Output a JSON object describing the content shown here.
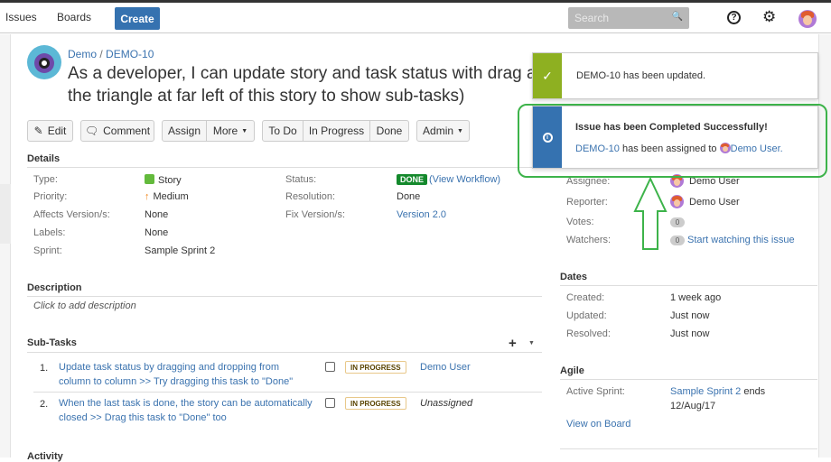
{
  "nav": {
    "issues": "Issues",
    "boards": "Boards",
    "create": "Create",
    "search_placeholder": "Search",
    "help_icon": "?"
  },
  "issue": {
    "project": "Demo",
    "key": "DEMO-10",
    "title_line1": "As a developer, I can update story and task status with drag a",
    "title_line2": "the triangle at far left of this story to show sub-tasks)"
  },
  "toolbar": {
    "edit": "Edit",
    "comment": "Comment",
    "assign": "Assign",
    "more": "More",
    "todo": "To Do",
    "in_progress": "In Progress",
    "done": "Done",
    "admin": "Admin"
  },
  "details": {
    "heading": "Details",
    "type_label": "Type:",
    "type_value": "Story",
    "priority_label": "Priority:",
    "priority_value": "Medium",
    "affects_label": "Affects Version/s:",
    "affects_value": "None",
    "labels_label": "Labels:",
    "labels_value": "None",
    "sprint_label": "Sprint:",
    "sprint_value": "Sample Sprint 2",
    "status_label": "Status:",
    "status_value": "DONE",
    "view_workflow": "(View Workflow)",
    "resolution_label": "Resolution:",
    "resolution_value": "Done",
    "fix_label": "Fix Version/s:",
    "fix_value": "Version 2.0"
  },
  "description": {
    "heading": "Description",
    "placeholder": "Click to add description"
  },
  "subtasks": {
    "heading": "Sub-Tasks",
    "items": [
      {
        "num": "1.",
        "line1": "Update task status by dragging and dropping from",
        "line2": "column to column >> Try dragging this task to \"Done\"",
        "status": "IN PROGRESS",
        "assignee": "Demo User"
      },
      {
        "num": "2.",
        "line1": "When the last task is done, the story can be automatically",
        "line2": "closed >> Drag this task to \"Done\" too",
        "status": "IN PROGRESS",
        "assignee": "Unassigned"
      }
    ]
  },
  "activity": {
    "heading": "Activity"
  },
  "people": {
    "assignee_label": "Assignee:",
    "assignee_value": "Demo User",
    "reporter_label": "Reporter:",
    "reporter_value": "Demo User",
    "votes_label": "Votes:",
    "votes_count": "0",
    "watchers_label": "Watchers:",
    "watchers_count": "0",
    "start_watching": "Start watching this issue"
  },
  "dates": {
    "heading": "Dates",
    "created_label": "Created:",
    "created_value": "1 week ago",
    "updated_label": "Updated:",
    "updated_value": "Just now",
    "resolved_label": "Resolved:",
    "resolved_value": "Just now"
  },
  "agile": {
    "heading": "Agile",
    "active_sprint_label": "Active Sprint:",
    "sprint_name": "Sample Sprint 2",
    "ends_text": "ends",
    "end_date": "12/Aug/17",
    "view_on_board": "View on Board"
  },
  "toasts": {
    "updated_msg": "DEMO-10 has been updated.",
    "success_title": "Issue has been Completed Successfully!",
    "assigned_key": "DEMO-10",
    "assigned_text": "has been assigned to",
    "assigned_user": "Demo User."
  },
  "colors": {
    "accent": "#3572b0",
    "done_green": "#14892c",
    "success_bar": "#8eb021",
    "highlight_green": "#3db34a"
  }
}
